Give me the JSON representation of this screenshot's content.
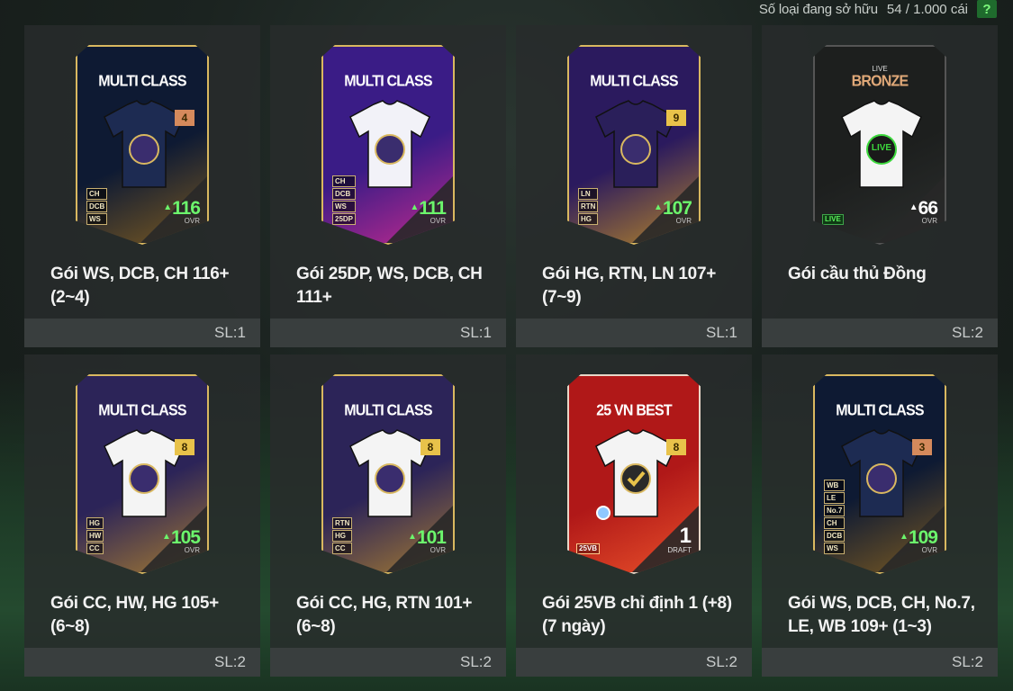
{
  "header": {
    "owned_label": "Số loại đang sở hữu",
    "owned_count": "54 / 1.000 cái",
    "help_label": "?"
  },
  "colors": {
    "ovr_green": "#6cf56c",
    "gold": "#d9b860"
  },
  "packs": [
    {
      "name": "Gói WS, DCB, CH 116+ (2~4)",
      "qty": "SL:1",
      "card_title": "MULTI CLASS",
      "level": "4",
      "positions": [
        "CH",
        "DCB",
        "WS"
      ],
      "ovr": "116",
      "ovr_label": "OVR",
      "jersey_color": "#1d2b52",
      "card_bg": [
        "#0e1a33",
        "#7a5a22"
      ],
      "badge_color": "#d58a5c"
    },
    {
      "name": "Gói 25DP, WS, DCB, CH 111+",
      "qty": "SL:1",
      "card_title": "MULTI CLASS",
      "level": "",
      "positions": [
        "CH",
        "DCB",
        "WS",
        "25DP"
      ],
      "ovr": "111",
      "ovr_label": "OVR",
      "jersey_color": "#f2f2f8",
      "card_bg": [
        "#3a1c86",
        "#c02a8e"
      ],
      "badge_color": ""
    },
    {
      "name": "Gói HG, RTN, LN 107+ (7~9)",
      "qty": "SL:1",
      "card_title": "MULTI CLASS",
      "level": "9",
      "positions": [
        "LN",
        "RTN",
        "HG"
      ],
      "ovr": "107",
      "ovr_label": "OVR",
      "jersey_color": "#2a1f5a",
      "card_bg": [
        "#2b1a5e",
        "#b2832b"
      ],
      "badge_color": "#e8c24a"
    },
    {
      "name": "Gói cầu thủ Đồng",
      "qty": "SL:2",
      "card_subtitle": "LIVE",
      "card_title": "BRONZE",
      "level": "",
      "positions": [],
      "live_tag": "LIVE",
      "jersey_text": "LIVE",
      "ovr": "66",
      "ovr_label": "OVR",
      "jersey_color": "#f4f4f4",
      "card_bg": [
        "#1d1f1e",
        "#2b2e2d"
      ],
      "badge_color": ""
    },
    {
      "name": "Gói CC, HW, HG 105+ (6~8)",
      "qty": "SL:2",
      "card_title": "MULTI CLASS",
      "level": "8",
      "positions": [
        "HG",
        "HW",
        "CC"
      ],
      "ovr": "105",
      "ovr_label": "OVR",
      "jersey_color": "#f4f4f4",
      "card_bg": [
        "#2c2458",
        "#a37a32"
      ],
      "badge_color": "#e8c24a"
    },
    {
      "name": "Gói CC, HG, RTN 101+ (6~8)",
      "qty": "SL:2",
      "card_title": "MULTI CLASS",
      "level": "8",
      "positions": [
        "RTN",
        "HG",
        "CC"
      ],
      "ovr": "101",
      "ovr_label": "OVR",
      "jersey_color": "#f4f4f4",
      "card_bg": [
        "#2c2458",
        "#a37a32"
      ],
      "badge_color": "#e8c24a"
    },
    {
      "name": "Gói 25VB chỉ định 1 (+8) (7 ngày)",
      "qty": "SL:2",
      "card_title": "25 VN BEST",
      "level": "8",
      "positions": [],
      "vb_tag": "25VB",
      "draft_num": "1",
      "draft_label": "DRAFT",
      "ovr": "",
      "ovr_label": "",
      "jersey_color": "#f4f4f4",
      "card_bg": [
        "#b01818",
        "#e8502a"
      ],
      "badge_color": "#e8c24a"
    },
    {
      "name": "Gói WS, DCB, CH, No.7, LE, WB 109+ (1~3)",
      "qty": "SL:2",
      "card_title": "MULTI CLASS",
      "level": "3",
      "positions": [
        "WB",
        "LE",
        "No.7",
        "CH",
        "DCB",
        "WS"
      ],
      "ovr": "109",
      "ovr_label": "OVR",
      "jersey_color": "#1d2b52",
      "card_bg": [
        "#0e1a33",
        "#7a5a22"
      ],
      "badge_color": "#d58a5c"
    }
  ]
}
